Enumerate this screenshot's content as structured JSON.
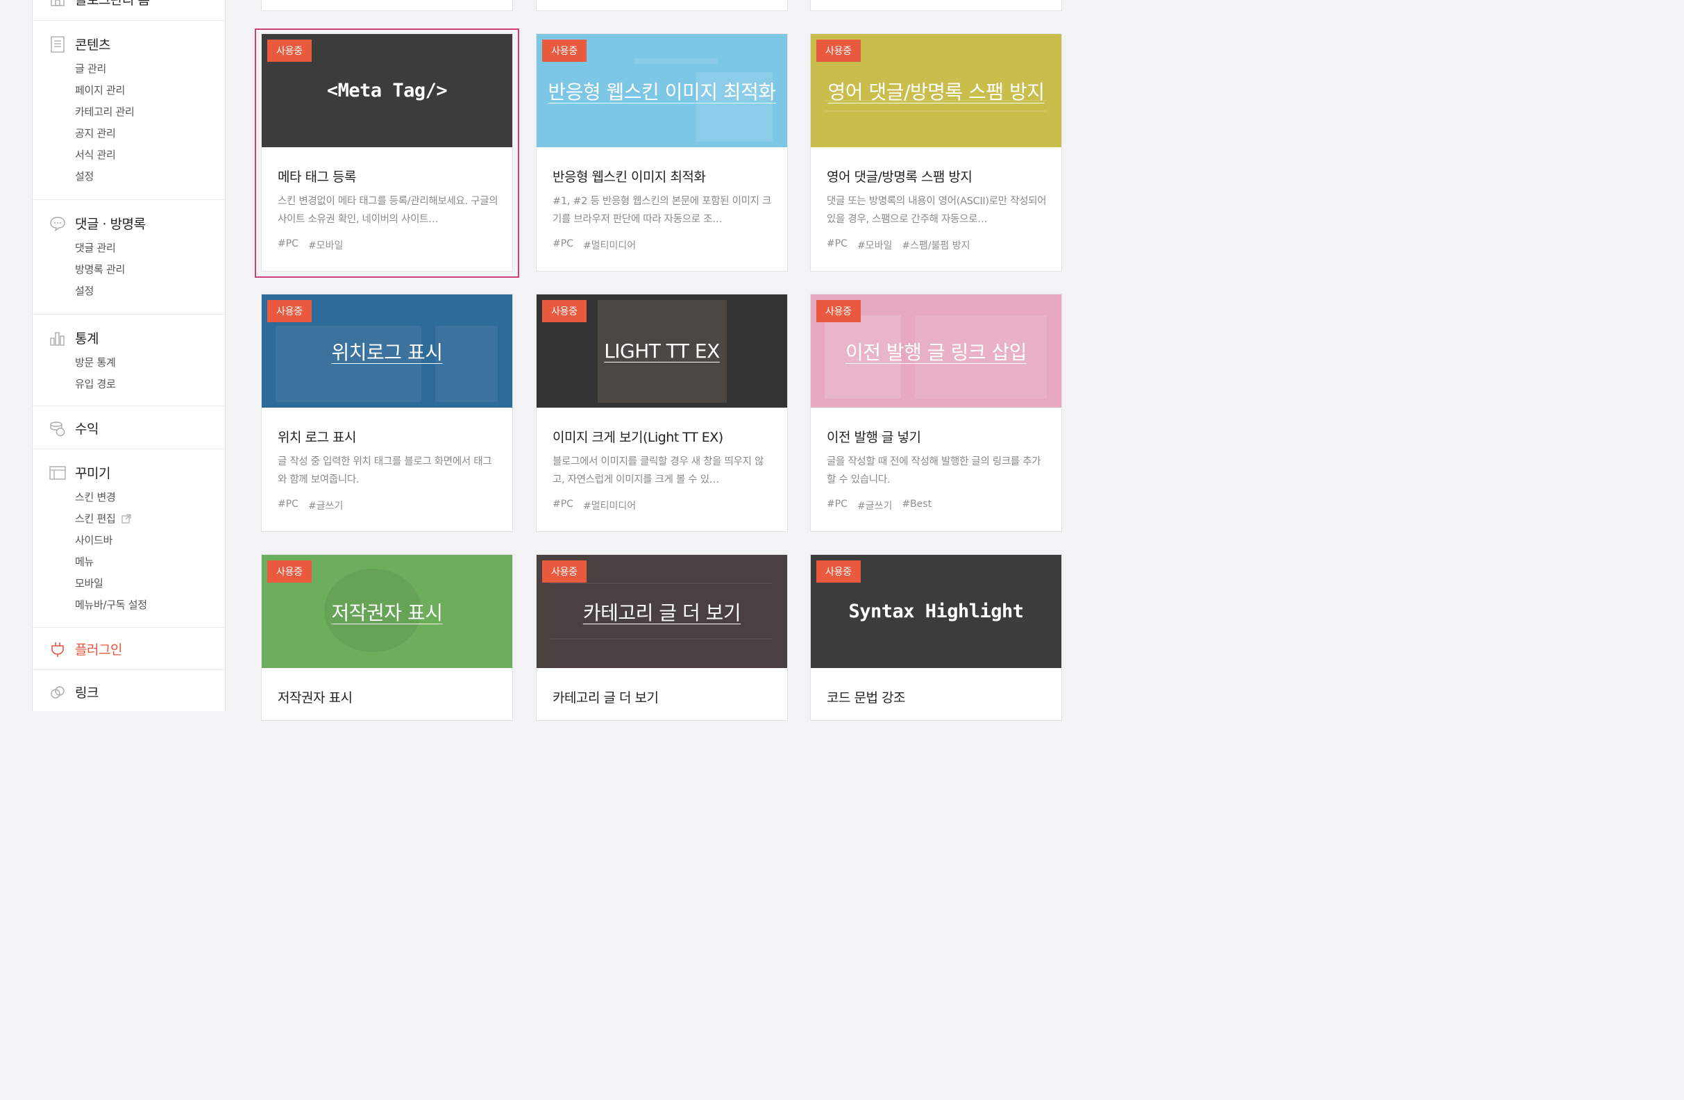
{
  "sidebar": {
    "top_partial": "블로그관리 홈",
    "sections": [
      {
        "title": "콘텐츠",
        "icon": "document-icon",
        "items": [
          "글 관리",
          "페이지 관리",
          "카테고리 관리",
          "공지 관리",
          "서식 관리",
          "설정"
        ]
      },
      {
        "title": "댓글 · 방명록",
        "icon": "speech-bubble-icon",
        "items": [
          "댓글 관리",
          "방명록 관리",
          "설정"
        ]
      },
      {
        "title": "통계",
        "icon": "bar-chart-icon",
        "items": [
          "방문 통계",
          "유입 경로"
        ]
      },
      {
        "title": "수익",
        "icon": "coins-icon",
        "items": []
      },
      {
        "title": "꾸미기",
        "icon": "layout-icon",
        "items": [
          "스킨 변경",
          "스킨 편집",
          "사이드바",
          "메뉴",
          "모바일",
          "메뉴바/구독 설정"
        ]
      },
      {
        "title": "플러그인",
        "icon": "plug-icon",
        "items": []
      },
      {
        "title": "링크",
        "icon": "link-icon",
        "items": []
      }
    ]
  },
  "badge_label": "사용중",
  "colors": {
    "accent": "#ea5a3e",
    "selected_border": "#cf3f78"
  },
  "plugins": [
    {
      "thumb_title": "<Meta Tag/>",
      "name": "메타 태그 등록",
      "desc": "스킨 변경없이 메타 태그를 등록/관리해보세요. 구글의 사이트 소유권 확인, 네이버의 사이트…",
      "tags": [
        "#PC",
        "#모바일"
      ],
      "color": "#3c3c3c"
    },
    {
      "thumb_title": "반응형 웹스킨 이미지 최적화",
      "name": "반응형 웹스킨 이미지 최적화",
      "desc": "#1, #2 등 반응형 웹스킨의 본문에 포함된 이미지 크기를 브라우저 판단에 따라 자동으로 조…",
      "tags": [
        "#PC",
        "#멀티미디어"
      ],
      "color": "#7cc6e6"
    },
    {
      "thumb_title": "영어 댓글/방명록 스팸 방지",
      "name": "영어 댓글/방명록 스팸 방지",
      "desc": "댓글 또는 방명록의 내용이 영어(ASCII)로만 작성되어 있을 경우, 스팸으로 간주해 자동으로…",
      "tags": [
        "#PC",
        "#모바일",
        "#스팸/불펌 방지"
      ],
      "color": "#c9bd4b"
    },
    {
      "thumb_title": "위치로그 표시",
      "name": "위치 로그 표시",
      "desc": "글 작성 중 입력한 위치 태그를 블로그 화면에서 태그와 함께 보여줍니다.",
      "tags": [
        "#PC",
        "#글쓰기"
      ],
      "color": "#2f6b98"
    },
    {
      "thumb_title": "LIGHT TT EX",
      "name": "이미지 크게 보기(Light TT EX)",
      "desc": "블로그에서 이미지를 클릭할 경우 새 창을 띄우지 않고, 자연스럽게 이미지를 크게 볼 수 있…",
      "tags": [
        "#PC",
        "#멀티미디어"
      ],
      "color": "#333333"
    },
    {
      "thumb_title": "이전 발행 글 링크 삽입",
      "name": "이전 발행 글 넣기",
      "desc": "글을 작성할 때 전에 작성해 발행한 글의 링크를 추가할 수 있습니다.",
      "tags": [
        "#PC",
        "#글쓰기",
        "#Best"
      ],
      "color": "#e6a9c0"
    },
    {
      "thumb_title": "저작권자 표시",
      "name": "저작권자 표시",
      "desc": "",
      "tags": [],
      "color": "#6dae5d"
    },
    {
      "thumb_title": "카테고리 글 더 보기",
      "name": "카테고리 글 더 보기",
      "desc": "",
      "tags": [],
      "color": "#4a4040"
    },
    {
      "thumb_title": "Syntax Highlight",
      "name": "코드 문법 강조",
      "desc": "",
      "tags": [],
      "color": "#3c3c3c"
    }
  ]
}
